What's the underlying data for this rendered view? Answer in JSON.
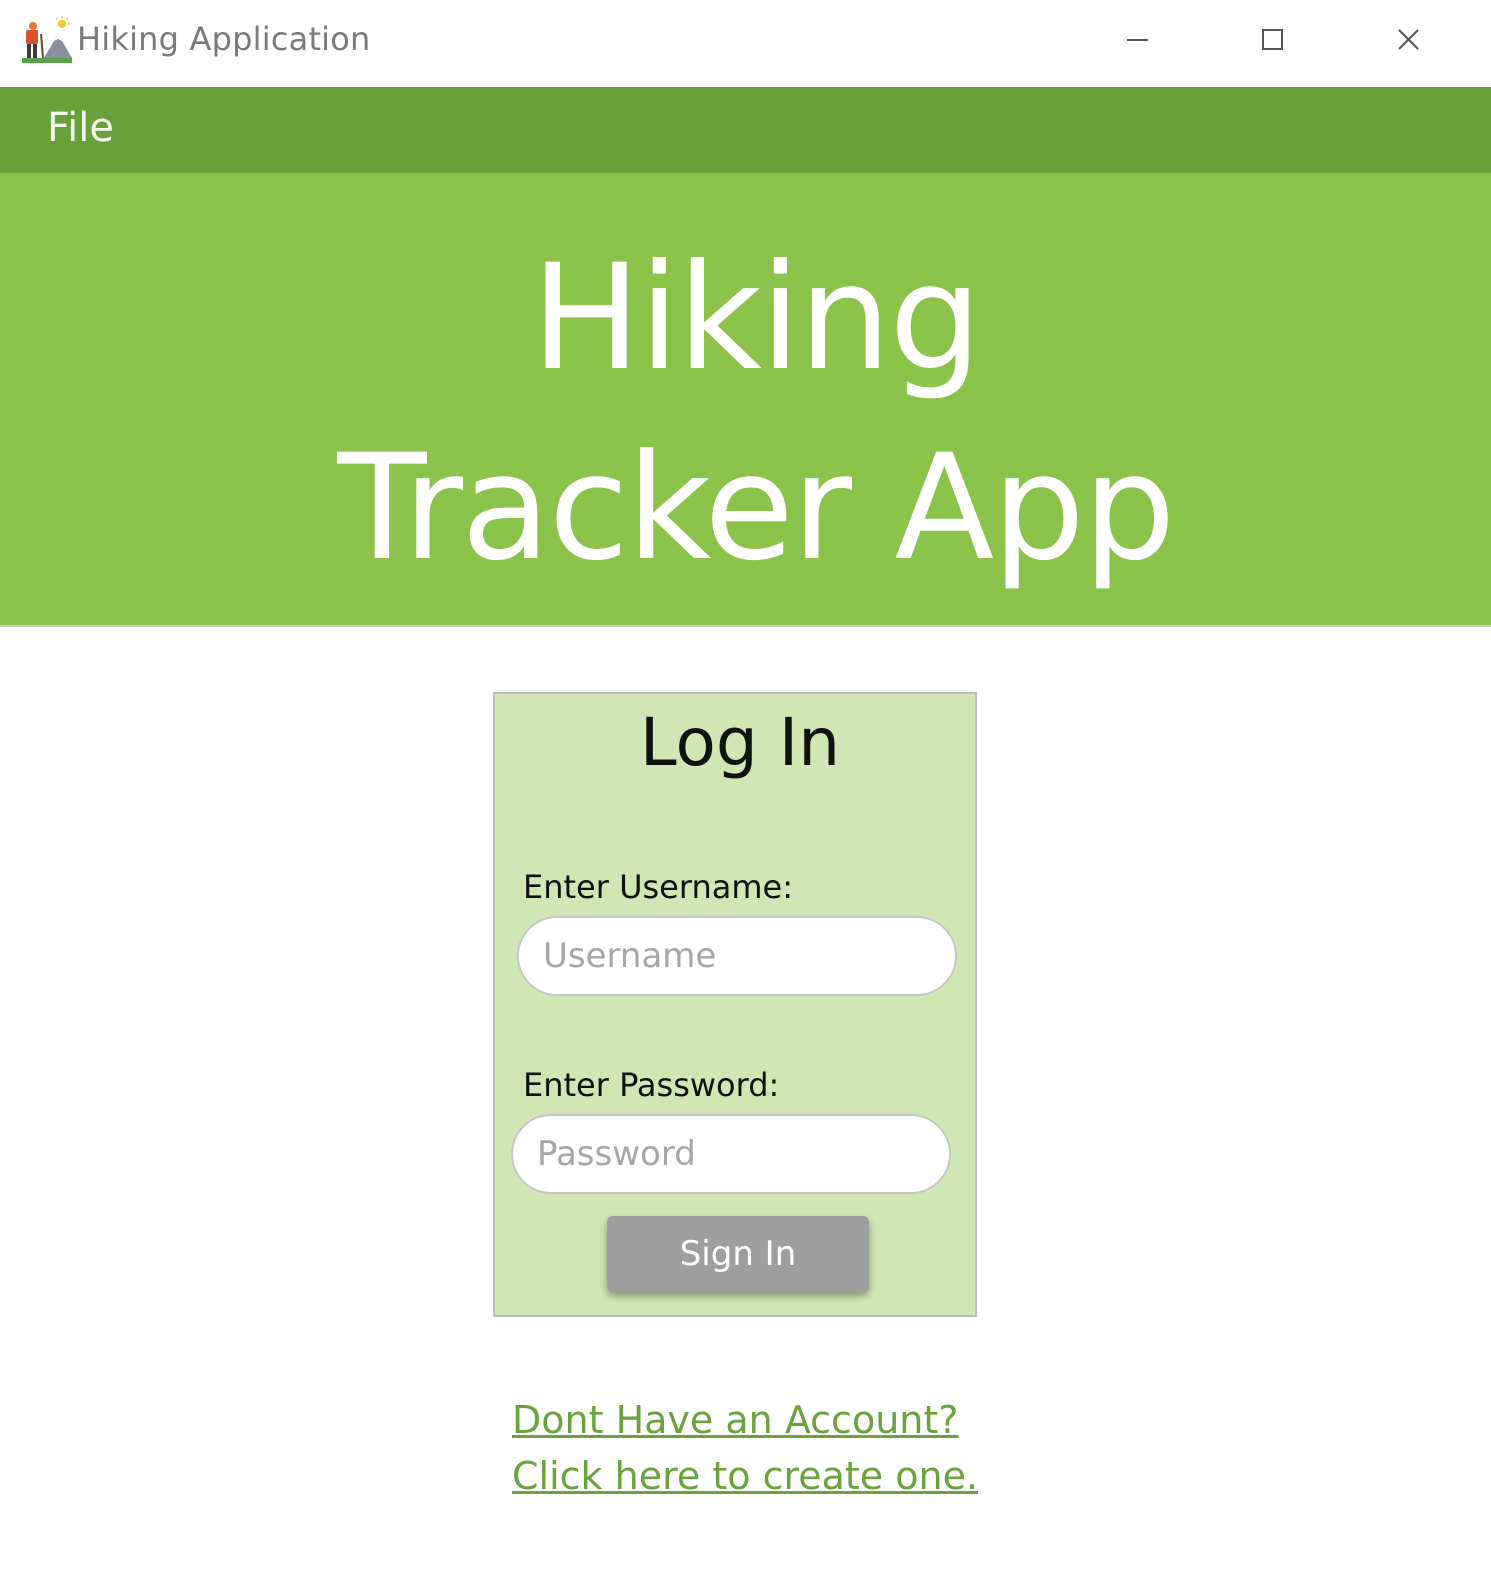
{
  "window": {
    "title": "Hiking Application",
    "icon": "hiker-mountain-icon",
    "controls": {
      "minimize": "minimize-icon",
      "maximize": "maximize-icon",
      "close": "close-icon"
    }
  },
  "menubar": {
    "items": [
      {
        "label": "File"
      }
    ]
  },
  "banner": {
    "line1": "Hiking",
    "line2": "Tracker App"
  },
  "login": {
    "title": "Log In",
    "username_label": "Enter Username:",
    "username_value": "",
    "username_placeholder": "Username",
    "password_label": "Enter Password:",
    "password_value": "",
    "password_placeholder": "Password",
    "signin_label": "Sign In"
  },
  "signup_link": {
    "line1": "Dont Have an Account? ",
    "line2": "Click here to create one."
  },
  "colors": {
    "menubar": "#69a03a",
    "banner": "#8bc34a",
    "card": "#d0e6b5",
    "button": "#9e9e9e",
    "link": "#6aa23c"
  }
}
